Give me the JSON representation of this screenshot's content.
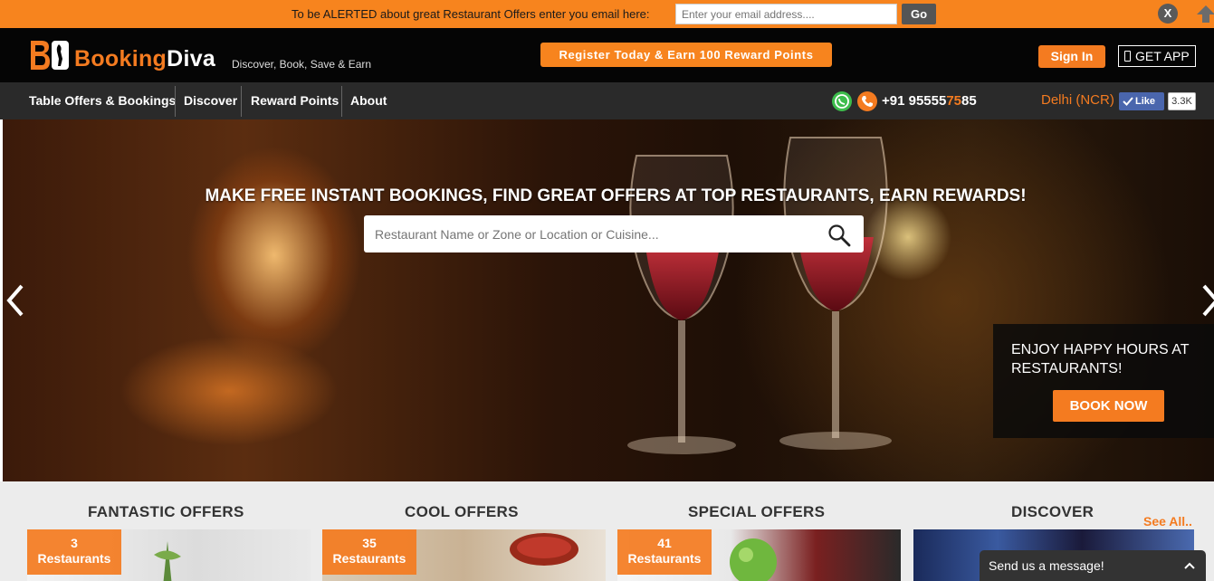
{
  "alert_bar": {
    "text": "To be ALERTED about great Restaurant Offers enter you email here:",
    "email_placeholder": "Enter your email address....",
    "go_label": "Go",
    "close_label": "X"
  },
  "header": {
    "logo_part1": "Booking",
    "logo_part2": "Diva",
    "tagline": "Discover, Book, Save & Earn",
    "register_label": "Register Today & Earn 100 Reward Points",
    "signin_label": "Sign In",
    "getapp_label": "GET APP"
  },
  "nav": {
    "items": [
      {
        "label": "Table Offers & Bookings"
      },
      {
        "label": "Discover"
      },
      {
        "label": "Reward Points"
      },
      {
        "label": "About"
      }
    ],
    "phone_prefix": "+91 95555",
    "phone_highlight": "75",
    "phone_suffix": "85",
    "city": "Delhi (NCR)",
    "fb_like": "Like",
    "fb_count": "3.3K"
  },
  "hero": {
    "headline": "MAKE FREE INSTANT BOOKINGS, FIND GREAT OFFERS AT TOP RESTAURANTS, EARN REWARDS!",
    "search_placeholder": "Restaurant Name or Zone or Location or Cuisine...",
    "promo_text": "ENJOY HAPPY HOURS AT RESTAURANTS!",
    "book_now": "BOOK NOW"
  },
  "offers": {
    "sections": [
      {
        "title": "FANTASTIC OFFERS",
        "count": "3",
        "unit": "Restaurants"
      },
      {
        "title": "COOL OFFERS",
        "count": "35",
        "unit": "Restaurants"
      },
      {
        "title": "SPECIAL OFFERS",
        "count": "41",
        "unit": "Restaurants"
      },
      {
        "title": "DISCOVER"
      }
    ],
    "see_all": "See All.."
  },
  "chat": {
    "label": "Send us a message!"
  },
  "colors": {
    "brand_orange": "#f47b20",
    "header_black": "#050505",
    "nav_gray": "#2a2a2a"
  }
}
